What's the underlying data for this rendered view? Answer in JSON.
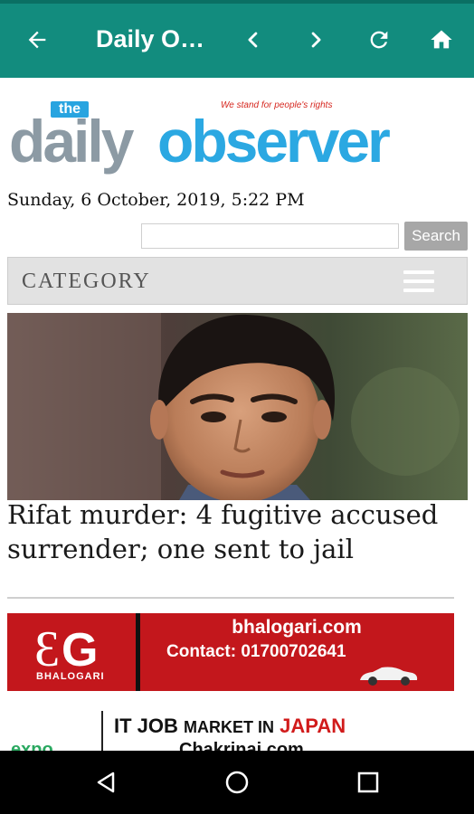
{
  "toolbar": {
    "title": "Daily Observer",
    "icons": [
      "arrow-left-icon",
      "chevron-left-icon",
      "chevron-right-icon",
      "refresh-icon",
      "home-icon"
    ],
    "color": "#128c7e"
  },
  "site": {
    "logo_the": "the",
    "logo_daily": "daily",
    "logo_observer": "observer",
    "tagline": "We stand for people's rights"
  },
  "dateline": "Sunday, 6 October, 2019, 5:22 PM",
  "search": {
    "value": "",
    "button_label": "Search"
  },
  "category": {
    "label": "CATEGORY",
    "icon": "hamburger-menu-icon"
  },
  "article": {
    "headline": "Rifat murder: 4 fugitive accused surrender; one sent to jail"
  },
  "ads": [
    {
      "logo_text": "BHALOGARI",
      "url": "bhalogari.com",
      "contact": "Contact: 01700702641",
      "color": "#c3171c"
    },
    {
      "logo_text": "expo",
      "line1_a": "IT JOB",
      "line1_b": "MARKET IN",
      "line1_c": "JAPAN",
      "line2": "Chakrinai.com"
    }
  ],
  "system_nav": {
    "icons": [
      "back-triangle-icon",
      "home-circle-icon",
      "recents-square-icon"
    ]
  }
}
